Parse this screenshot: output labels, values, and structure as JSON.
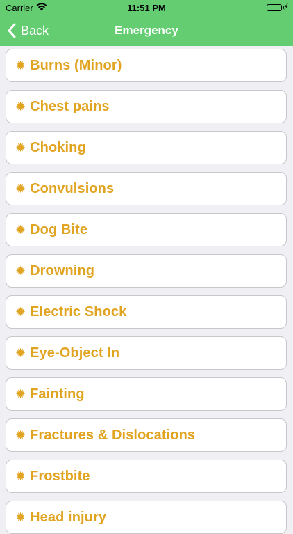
{
  "status_bar": {
    "carrier": "Carrier",
    "time": "11:51 PM",
    "wifi_icon": "wifi-icon",
    "battery_icon": "battery-icon",
    "charging_icon": "bolt-icon"
  },
  "nav": {
    "back_label": "Back",
    "back_icon": "chevron-left-icon",
    "title": "Emergency"
  },
  "items": [
    {
      "label": "Burns (Minor)"
    },
    {
      "label": "Chest pains"
    },
    {
      "label": "Choking"
    },
    {
      "label": "Convulsions"
    },
    {
      "label": "Dog Bite"
    },
    {
      "label": "Drowning"
    },
    {
      "label": "Electric Shock"
    },
    {
      "label": "Eye-Object In"
    },
    {
      "label": "Fainting"
    },
    {
      "label": "Fractures & Dislocations"
    },
    {
      "label": "Frostbite"
    },
    {
      "label": "Head injury"
    }
  ],
  "colors": {
    "nav_background": "#64cd72",
    "item_text": "#e1a421",
    "page_background": "#efeff4"
  },
  "item_bullet_icon": "sun-bullet-icon"
}
